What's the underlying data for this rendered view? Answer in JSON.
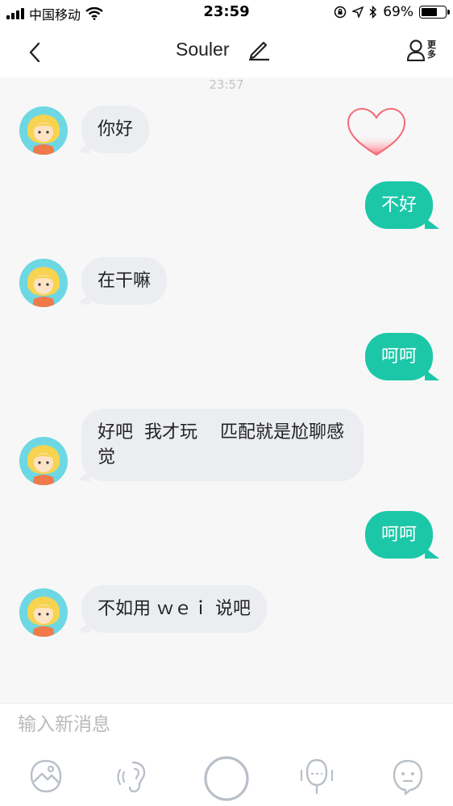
{
  "status_bar": {
    "carrier": "中国移动",
    "time": "23:59",
    "battery_percent": "69%",
    "battery_level": 0.69
  },
  "nav": {
    "title": "Souler",
    "more_label": "更多",
    "back_icon": "chevron-left-icon",
    "edit_icon": "pencil-icon",
    "more_icon": "user-icon"
  },
  "chat": {
    "timestamp": "23:57",
    "messages": [
      {
        "side": "in",
        "text": "你好"
      },
      {
        "side": "out",
        "text": "不好"
      },
      {
        "side": "in",
        "text": "在干嘛"
      },
      {
        "side": "out",
        "text": "呵呵"
      },
      {
        "side": "in",
        "text": "好吧  我才玩    匹配就是尬聊感觉"
      },
      {
        "side": "out",
        "text": "呵呵"
      },
      {
        "side": "in",
        "text": "不如用 ｗｅｉ 说吧"
      }
    ]
  },
  "input": {
    "placeholder": "输入新消息"
  },
  "toolbar": {
    "items": [
      "image-icon",
      "voice-icon",
      "record-button-icon",
      "mic-icon",
      "emoji-icon"
    ]
  },
  "colors": {
    "accent": "#1cc7a8",
    "incoming_bubble": "#ebedf0",
    "chat_background": "#f7f7f7"
  }
}
